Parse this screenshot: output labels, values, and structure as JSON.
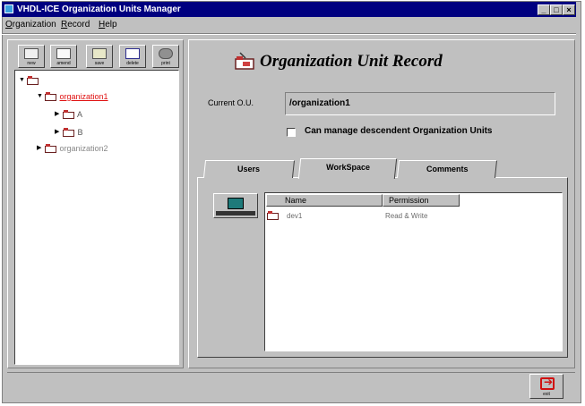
{
  "window": {
    "title": "VHDL-ICE Organization Units Manager",
    "minimize_icon": "minimize-icon",
    "maximize_icon": "maximize-icon",
    "close_icon": "close-icon"
  },
  "menu": [
    "Organization",
    "Record",
    "Help"
  ],
  "toolbar": [
    {
      "label": "new",
      "icon": "new-record-icon"
    },
    {
      "label": "amend",
      "icon": "amend-icon"
    },
    {
      "label": "save",
      "icon": "save-icon"
    },
    {
      "label": "delete",
      "icon": "delete-icon"
    },
    {
      "label": "print",
      "icon": "print-icon"
    }
  ],
  "tree": {
    "root_icon": "folder-icon",
    "nodes": [
      {
        "label": "organization1",
        "selected": true,
        "color": "#e01010"
      },
      {
        "label": "A",
        "selected": false
      },
      {
        "label": "B",
        "selected": false
      },
      {
        "label": "organization2",
        "selected": false
      }
    ]
  },
  "record": {
    "title": "Organization Unit Record",
    "title_icon": "organization-folder-icon",
    "current_ou_label": "Current O.U.",
    "current_ou_value": "/organization1",
    "checkbox_label": "Can manage descendent Organization Units",
    "checkbox_checked": false
  },
  "tabs": [
    {
      "label": "Users",
      "active": false
    },
    {
      "label": "WorkSpace",
      "active": true
    },
    {
      "label": "Comments",
      "active": false
    }
  ],
  "workspace": {
    "add_button_icon": "workspace-computer-icon",
    "columns": [
      "Name",
      "Permission"
    ],
    "rows": [
      {
        "name": "dev1",
        "permission": "Read & Write",
        "icon": "folder-icon"
      }
    ]
  },
  "exit_button": {
    "label": "exit",
    "icon": "exit-icon"
  }
}
